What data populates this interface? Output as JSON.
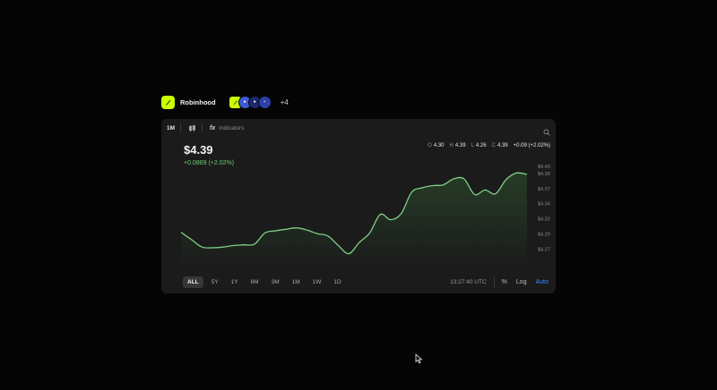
{
  "brand": {
    "name": "Robinhood",
    "more": "+4",
    "chips": [
      "#ccff00",
      "#3b5bdb",
      "#1e2a6e",
      "#2d3fa8"
    ]
  },
  "toolbar": {
    "interval": "1M",
    "indicators_label": "Indicators"
  },
  "quote": {
    "price": "$4.39",
    "change": "+0.0869 (+2.02%)",
    "ohlc": [
      {
        "key": "O",
        "value": "4.30"
      },
      {
        "key": "H",
        "value": "4.39"
      },
      {
        "key": "L",
        "value": "4.26"
      },
      {
        "key": "C",
        "value": "4.39"
      }
    ],
    "delta": "+0.09 (+2.02%)"
  },
  "ranges": [
    {
      "label": "ALL",
      "active": true
    },
    {
      "label": "5Y",
      "active": false
    },
    {
      "label": "1Y",
      "active": false
    },
    {
      "label": "6M",
      "active": false
    },
    {
      "label": "3M",
      "active": false
    },
    {
      "label": "1M",
      "active": false
    },
    {
      "label": "1W",
      "active": false
    },
    {
      "label": "1D",
      "active": false
    }
  ],
  "footer": {
    "clock": "13:27:40 UTC",
    "percent": "%",
    "log": "Log",
    "auto": "Auto"
  },
  "colors": {
    "line": "#7fcf86",
    "accent": "#3d8bff",
    "brand": "#ccff00"
  },
  "chart_data": {
    "type": "area",
    "ylim": [
      4.26,
      4.405
    ],
    "yticks": [
      "$4.40",
      "$4.39",
      "$4.37",
      "$4.34",
      "$4.32",
      "$4.29",
      "$4.27"
    ],
    "ytick_values": [
      4.399,
      4.389,
      4.369,
      4.349,
      4.328,
      4.308,
      4.287
    ],
    "values": [
      4.31,
      4.3,
      4.29,
      4.289,
      4.29,
      4.292,
      4.293,
      4.294,
      4.309,
      4.312,
      4.314,
      4.316,
      4.313,
      4.308,
      4.305,
      4.292,
      4.281,
      4.296,
      4.309,
      4.334,
      4.327,
      4.335,
      4.364,
      4.37,
      4.373,
      4.374,
      4.382,
      4.382,
      4.361,
      4.367,
      4.362,
      4.381,
      4.39,
      4.388
    ]
  }
}
